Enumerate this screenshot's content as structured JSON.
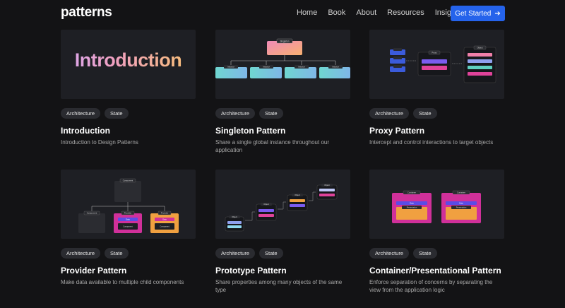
{
  "header": {
    "logo": "patterns",
    "nav": [
      "Home",
      "Book",
      "About",
      "Resources",
      "Insights"
    ],
    "cta_label": "Get Started",
    "cta_icon": "arrow-right-icon"
  },
  "thumb_labels": {
    "introduction": "Introduction",
    "singleton": "Singleton",
    "instance": "Instance",
    "proxy": "Proxy",
    "object": "Object",
    "handler": "Handler",
    "component": "Component",
    "provider": "Provider",
    "data": "Data",
    "container": "Container",
    "presentation": "Presentation"
  },
  "cards": [
    {
      "tags": [
        "Architecture",
        "State"
      ],
      "title": "Introduction",
      "desc": "Introduction to Design Patterns"
    },
    {
      "tags": [
        "Architecture",
        "State"
      ],
      "title": "Singleton Pattern",
      "desc": "Share a single global instance throughout our application"
    },
    {
      "tags": [
        "Architecture",
        "State"
      ],
      "title": "Proxy Pattern",
      "desc": "Intercept and control interactions to target objects"
    },
    {
      "tags": [
        "Architecture",
        "State"
      ],
      "title": "Provider Pattern",
      "desc": "Make data available to multiple child components"
    },
    {
      "tags": [
        "Architecture",
        "State"
      ],
      "title": "Prototype Pattern",
      "desc": "Share properties among many objects of the same type"
    },
    {
      "tags": [
        "Architecture",
        "State"
      ],
      "title": "Container/Presentational Pattern",
      "desc": "Enforce separation of concerns by separating the view from the application logic"
    }
  ]
}
